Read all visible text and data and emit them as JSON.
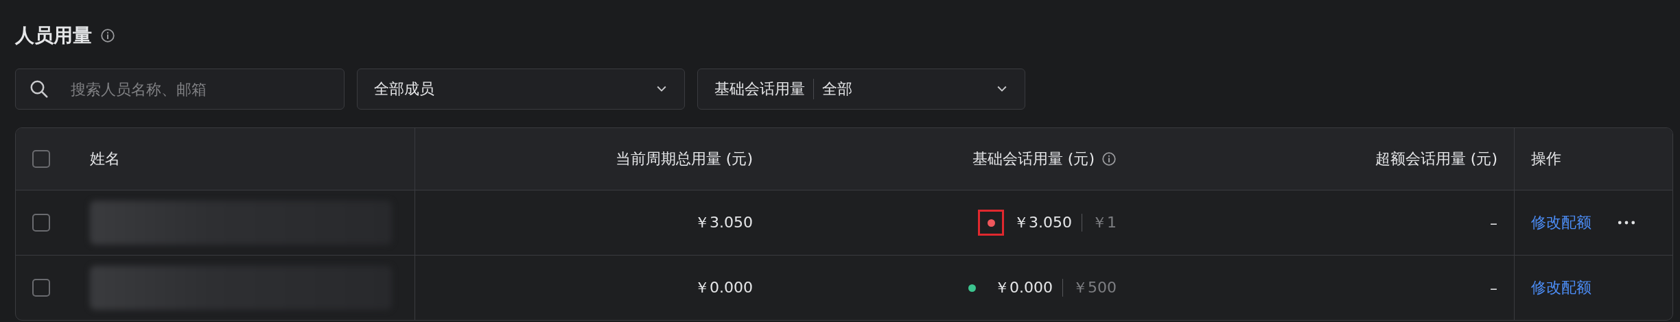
{
  "title": "人员用量",
  "filters": {
    "search": {
      "placeholder": "搜索人员名称、邮箱"
    },
    "member": {
      "value": "全部成员"
    },
    "usage": {
      "label": "基础会话用量",
      "value": "全部"
    }
  },
  "table": {
    "header_checked": false,
    "columns": [
      {
        "label": "姓名"
      },
      {
        "label": "当前周期总用量 (元)"
      },
      {
        "label": "基础会话用量 (元)"
      },
      {
        "label": "超额会话用量 (元)"
      },
      {
        "label": "操作"
      }
    ],
    "rows": [
      {
        "checked": false,
        "name": {
          "kind": "redacted"
        },
        "total": "￥3.050",
        "basic": {
          "color": "#f0575c",
          "highlighted": true,
          "amount": "￥3.050",
          "quota": "￥1"
        },
        "excess": "–",
        "action": "修改配额",
        "more": true
      },
      {
        "checked": false,
        "name": {
          "kind": "redacted"
        },
        "total": "￥0.000",
        "basic": {
          "color": "#3cc48f",
          "highlighted": false,
          "amount": "￥0.000",
          "quota": "￥500"
        },
        "excess": "–",
        "action": "修改配额",
        "more": false
      }
    ]
  }
}
